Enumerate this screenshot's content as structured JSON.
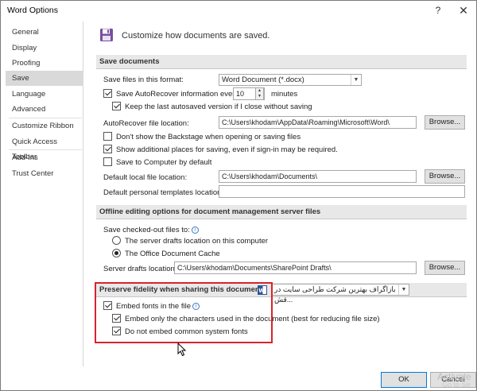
{
  "window": {
    "title": "Word Options",
    "help_glyph": "?",
    "close_glyph": "✕"
  },
  "sidebar": {
    "items": [
      {
        "label": "General"
      },
      {
        "label": "Display"
      },
      {
        "label": "Proofing"
      },
      {
        "label": "Save"
      },
      {
        "label": "Language"
      },
      {
        "label": "Advanced"
      },
      {
        "label": "Customize Ribbon"
      },
      {
        "label": "Quick Access Toolbar"
      },
      {
        "label": "Add-Ins"
      },
      {
        "label": "Trust Center"
      }
    ],
    "selected": "Save"
  },
  "header": {
    "text": "Customize how documents are saved.",
    "icon": "floppy-disk-icon"
  },
  "save_documents": {
    "title": "Save documents",
    "format_label": "Save files in this format:",
    "format_value": "Word Document (*.docx)",
    "autorecover_label": "Save AutoRecover information every",
    "autorecover_value": "10",
    "minutes_label": "minutes",
    "keep_last_label": "Keep the last autosaved version if I close without saving",
    "autorecover_location_label": "AutoRecover file location:",
    "autorecover_location_value": "C:\\Users\\khodam\\AppData\\Roaming\\Microsoft\\Word\\",
    "browse_label": "Browse...",
    "backstage_label": "Don't show the Backstage when opening or saving files",
    "additional_places_label": "Show additional places for saving, even if sign-in may be required.",
    "save_to_computer_label": "Save to Computer by default",
    "default_local_label": "Default local file location:",
    "default_local_value": "C:\\Users\\khodam\\Documents\\",
    "default_templates_label": "Default personal templates location:",
    "default_templates_value": ""
  },
  "offline": {
    "title": "Offline editing options for document management server files",
    "save_checked_out_label": "Save checked-out files to:",
    "server_drafts_option": "The server drafts location on this computer",
    "office_cache_option": "The Office Document Cache",
    "server_drafts_label": "Server drafts location:",
    "server_drafts_value": "C:\\Users\\khodam\\Documents\\SharePoint Drafts\\"
  },
  "fidelity": {
    "title": "Preserve fidelity when sharing this document:",
    "document_value": "بازاگراف بهترین شرکت طراحی سایت در قش...",
    "embed_fonts_label": "Embed fonts in the file",
    "embed_only_label": "Embed only the characters used in the document (best for reducing file size)",
    "no_common_label": "Do not embed common system fonts"
  },
  "footer": {
    "ok_label": "OK",
    "cancel_label": "Cancel"
  },
  "watermark": {
    "line1": "Activate",
    "line2": "Go to Se"
  },
  "colors": {
    "highlight_box": "#d9232b",
    "selected_nav": "#d9d9d9",
    "section_bg": "#e8e8e8"
  }
}
